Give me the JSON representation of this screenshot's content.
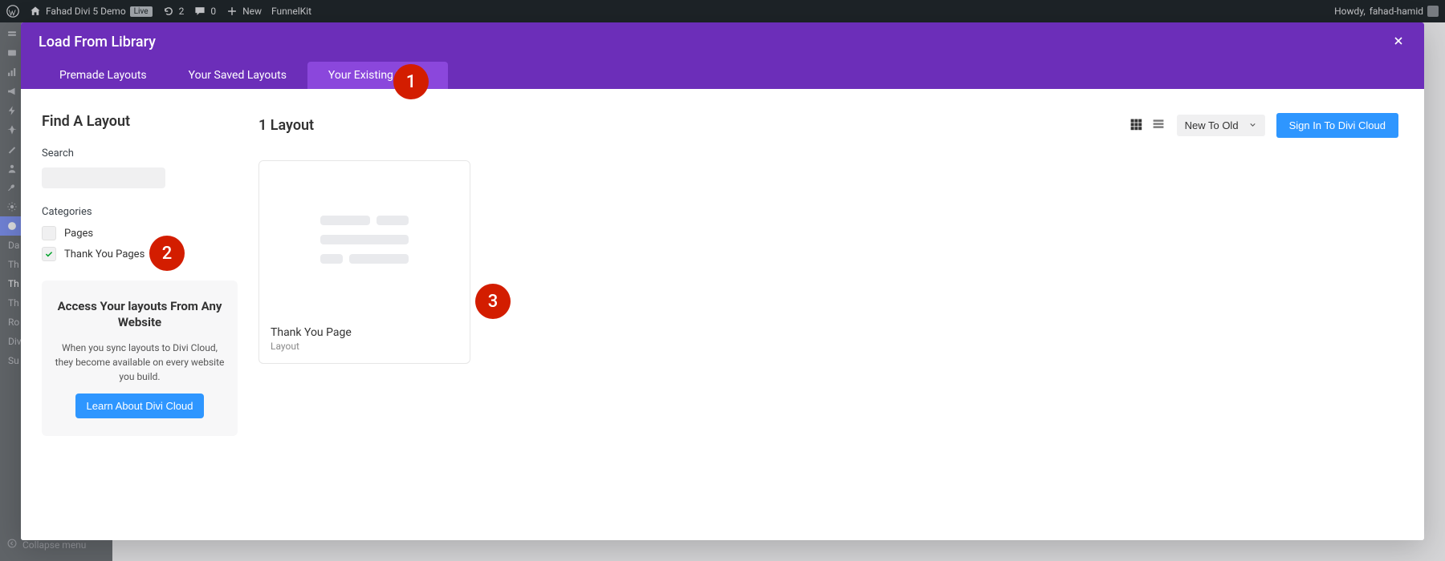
{
  "adminbar": {
    "site_title": "Fahad Divi 5 Demo",
    "live_badge": "Live",
    "refresh_count": "2",
    "comments_count": "0",
    "new_label": "New",
    "funnelkit_label": "FunnelKit",
    "howdy_prefix": "Howdy,",
    "user_name": "fahad-hamid"
  },
  "sidebar": {
    "collapse_label": "Collapse menu",
    "items": [
      {
        "label": ""
      },
      {
        "label": ""
      },
      {
        "label": ""
      },
      {
        "label": ""
      },
      {
        "label": ""
      },
      {
        "label": ""
      },
      {
        "label": ""
      },
      {
        "label": ""
      },
      {
        "label": ""
      },
      {
        "label": ""
      },
      {
        "label": ""
      },
      {
        "label": ""
      },
      {
        "label": ""
      }
    ],
    "submenu": [
      "Da",
      "Th",
      "Th",
      "Th",
      "Ro",
      "Div",
      "Su"
    ]
  },
  "modal": {
    "title": "Load From Library",
    "tabs": [
      {
        "label": "Premade Layouts",
        "active": false
      },
      {
        "label": "Your Saved Layouts",
        "active": false
      },
      {
        "label": "Your Existing Pages",
        "active": true
      }
    ],
    "find": {
      "title": "Find A Layout",
      "search_label": "Search",
      "categories_label": "Categories",
      "categories": [
        {
          "label": "Pages",
          "checked": false
        },
        {
          "label": "Thank You Pages",
          "checked": true
        }
      ],
      "cloud": {
        "title": "Access Your layouts From Any Website",
        "desc": "When you sync layouts to Divi Cloud, they become available on every website you build.",
        "button": "Learn About Divi Cloud"
      }
    },
    "results": {
      "count_label": "1 Layout",
      "sort_label": "New To Old",
      "signin_label": "Sign In To Divi Cloud",
      "items": [
        {
          "name": "Thank You Page",
          "sub": "Layout"
        }
      ]
    }
  },
  "annotations": {
    "step1": "1",
    "step2": "2",
    "step3": "3"
  }
}
